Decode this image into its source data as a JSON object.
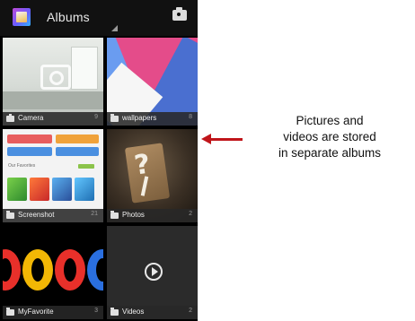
{
  "actionbar": {
    "title": "Albums",
    "camera_icon": "camera-icon"
  },
  "albums": [
    {
      "name": "Camera",
      "count": "9",
      "icon": "camera-icon"
    },
    {
      "name": "wallpapers",
      "count": "8",
      "icon": "folder-icon"
    },
    {
      "name": "Screenshot",
      "count": "21",
      "icon": "folder-icon"
    },
    {
      "name": "Photos",
      "count": "2",
      "icon": "folder-icon"
    },
    {
      "name": "MyFavorite",
      "count": "3",
      "icon": "folder-icon"
    },
    {
      "name": "Videos",
      "count": "2",
      "icon": "folder-icon"
    }
  ],
  "screenshot_thumb": {
    "favorites_label": "Our Favorites"
  },
  "annotation": {
    "line1": "Pictures and",
    "line2": "videos are stored",
    "line3": "in separate albums",
    "arrow_color": "#c0151a"
  }
}
